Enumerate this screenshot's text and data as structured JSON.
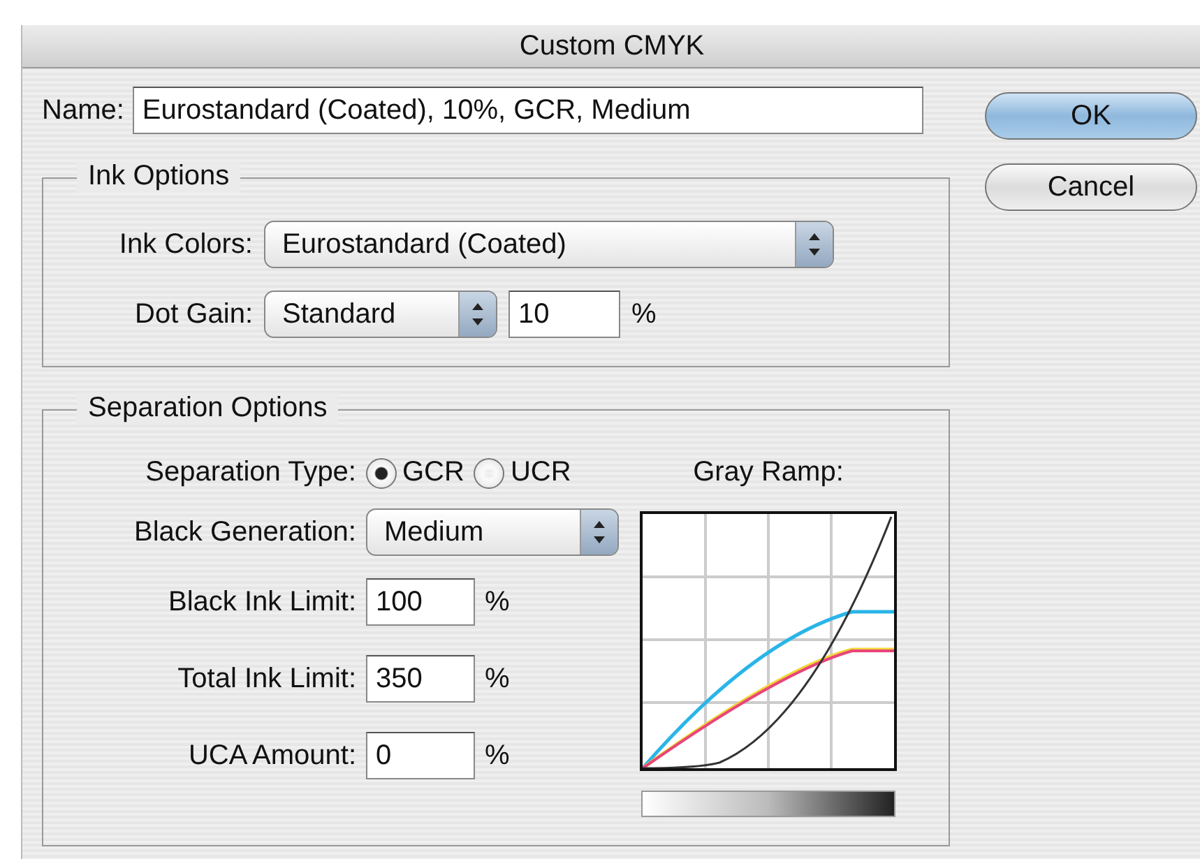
{
  "window": {
    "title": "Custom CMYK"
  },
  "name_field": {
    "label": "Name:",
    "value": "Eurostandard (Coated), 10%, GCR, Medium"
  },
  "buttons": [
    {
      "label": "OK",
      "default": true
    },
    {
      "label": "Cancel",
      "default": false
    }
  ],
  "ink_options": {
    "title": "Ink Options",
    "ink_colors": {
      "label": "Ink Colors:",
      "value": "Eurostandard (Coated)"
    },
    "dot_gain": {
      "label": "Dot Gain:",
      "method": "Standard",
      "value": "10",
      "unit": "%"
    }
  },
  "separation_options": {
    "title": "Separation Options",
    "separation_type": {
      "label": "Separation Type:",
      "options": [
        {
          "label": "GCR",
          "selected": true
        },
        {
          "label": "UCR",
          "selected": false
        }
      ]
    },
    "black_generation": {
      "label": "Black Generation:",
      "value": "Medium"
    },
    "limits": [
      {
        "label": "Black Ink Limit:",
        "value": "100",
        "unit": "%"
      },
      {
        "label": "Total Ink Limit:",
        "value": "350",
        "unit": "%"
      },
      {
        "label": "UCA Amount:",
        "value": "0",
        "unit": "%"
      }
    ],
    "gray_ramp": {
      "label": "Gray Ramp:"
    }
  }
}
